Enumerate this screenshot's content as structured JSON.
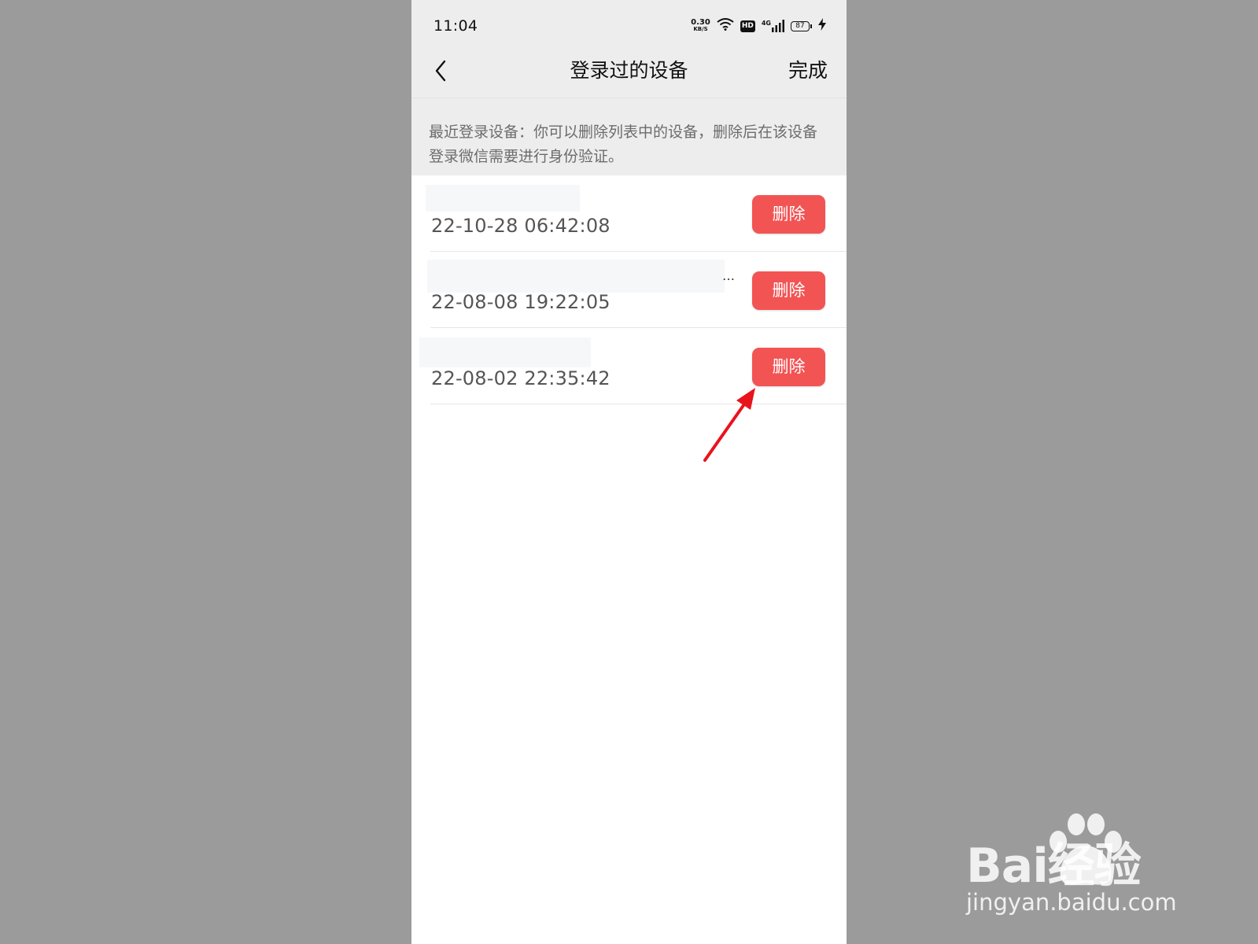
{
  "status_bar": {
    "time": "11:04",
    "net_speed": "0.30",
    "net_unit": "KB/S",
    "hd_label": "HD",
    "network_label": "4G",
    "battery_level": "87",
    "icons": [
      "wifi-icon",
      "signal-icon",
      "charging-icon"
    ]
  },
  "nav": {
    "back_icon": "chevron-left-icon",
    "title": "登录过的设备",
    "done_label": "完成"
  },
  "info": {
    "text": "最近登录设备：你可以删除列表中的设备，删除后在该设备登录微信需要进行身份验证。"
  },
  "devices": [
    {
      "name_redacted": true,
      "time": "22-10-28 06:42:08",
      "delete_label": "删除"
    },
    {
      "name_redacted": true,
      "name_truncated_mark": "…",
      "time": "22-08-08 19:22:05",
      "delete_label": "删除"
    },
    {
      "name_redacted": true,
      "time": "22-08-02 22:35:42",
      "delete_label": "删除"
    }
  ],
  "colors": {
    "page_background": "#9b9b9b",
    "header_background": "#ededed",
    "delete_button": "#f25454",
    "annotation_arrow": "#e8141c"
  },
  "watermark": {
    "brand": "Bai经验",
    "url": "jingyan.baidu.com"
  }
}
